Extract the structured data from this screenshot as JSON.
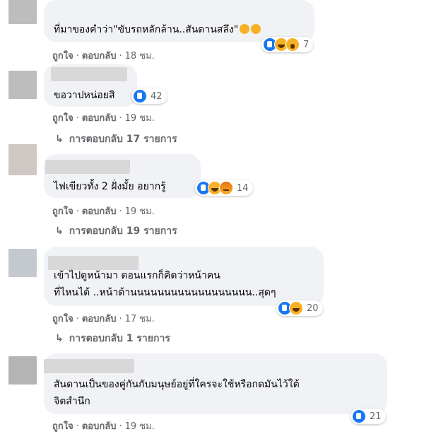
{
  "comments": [
    {
      "text_lines": [
        "ที่มาของคำว่า\"ขับรถหลักล้าน..สันดานสลึง\""
      ],
      "trailing_emojis": [
        "grin-emoji",
        "grin-emoji"
      ],
      "like_label": "ถูกใจ",
      "reply_label": "ตอบกลับ",
      "time": "18 ชม.",
      "reactions": [
        "like",
        "haha",
        "wow"
      ],
      "reaction_count": "7"
    },
    {
      "text_lines": [
        "ขอวาปหน่อยสิ"
      ],
      "like_label": "ถูกใจ",
      "reply_label": "ตอบกลับ",
      "time": "19 ชม.",
      "reactions": [
        "like"
      ],
      "reaction_count": "42",
      "replies_label": "การตอบกลับ 17 รายการ"
    },
    {
      "text_lines": [
        "ไฟเขียวทั้ง 2 ฝั่งมั้ย อยากรู้"
      ],
      "like_label": "ถูกใจ",
      "reply_label": "ตอบกลับ",
      "time": "19 ชม.",
      "reactions": [
        "like",
        "haha",
        "angry"
      ],
      "reaction_count": "14",
      "replies_label": "การตอบกลับ 19 รายการ"
    },
    {
      "text_lines": [
        "เข้าไปดูหน้ามา ตอนแรกก็คิดว่าหน้าคน",
        "ที่ไหนได้ ..หน้าด้านนนนนนนนนนนนนนนนนน..สุดๆ"
      ],
      "like_label": "ถูกใจ",
      "reply_label": "ตอบกลับ",
      "time": "17 ชม.",
      "reactions": [
        "like",
        "haha"
      ],
      "reaction_count": "20",
      "replies_label": "การตอบกลับ 1 รายการ"
    },
    {
      "text_lines": [
        "สันดานเป็นของคู่กันกับมนุษย์อยู่ที่ใครจะใช้หรือกดมันไว้ใต้",
        "จิตสำนึก"
      ],
      "like_label": "ถูกใจ",
      "reply_label": "ตอบกลับ",
      "time": "19 ชม.",
      "reactions": [
        "like"
      ],
      "reaction_count": "21"
    }
  ],
  "colors": {
    "bubble": "#f0f2f5",
    "meta": "#65676b",
    "like": "#1877f2",
    "emoji": "#f7b125"
  }
}
